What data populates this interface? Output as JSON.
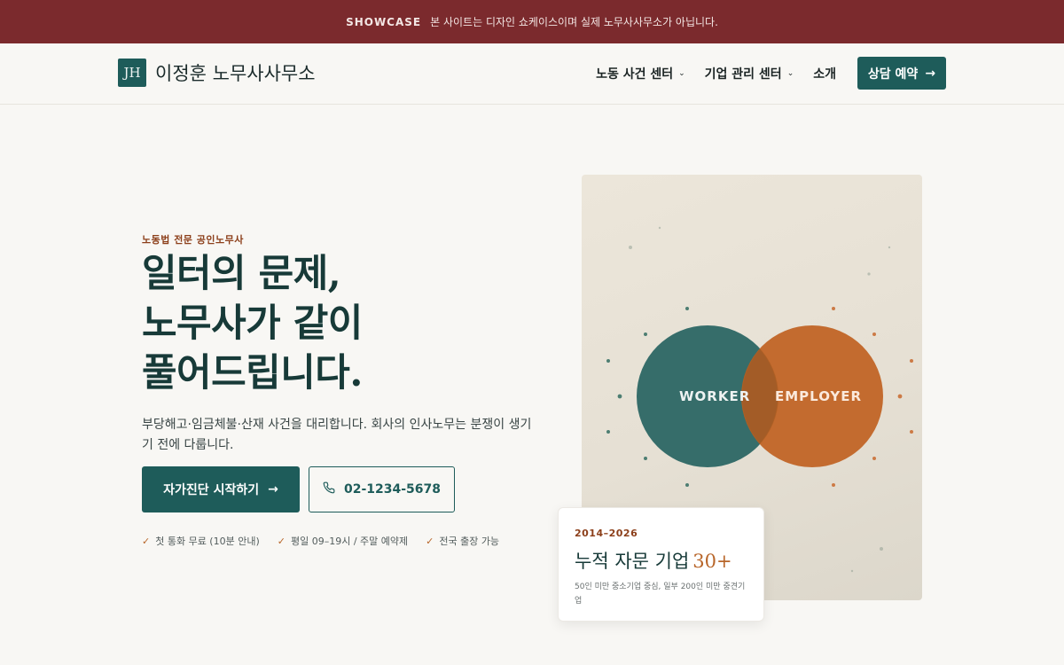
{
  "banner": {
    "tag": "SHOWCASE",
    "text": "본 사이트는 디자인 쇼케이스이며 실제 노무사사무소가 아닙니다."
  },
  "header": {
    "logo_mark": "JH",
    "logo_text": "이정훈 노무사사무소",
    "nav": [
      {
        "label": "노동 사건 센터",
        "dropdown": true
      },
      {
        "label": "기업 관리 센터",
        "dropdown": true
      },
      {
        "label": "소개",
        "dropdown": false
      }
    ],
    "cta_label": "상담 예약",
    "cta_icon": "arrow-right-icon"
  },
  "hero": {
    "eyebrow": "노동법 전문 공인노무사",
    "headline_lines": [
      "일터의 문제,",
      "노무사가 같이",
      "풀어드립니다."
    ],
    "subtext": "부당해고·임금체불·산재 사건을 대리합니다. 회사의 인사노무는 분쟁이 생기기 전에 다룹니다.",
    "primary_button": "자가진단 시작하기",
    "phone_button": "02-1234-5678",
    "checks": [
      "첫 통화 무료 (10분 안내)",
      "평일 09–19시 / 주말 예약제",
      "전국 출장 가능"
    ]
  },
  "illustration": {
    "left_circle": "WORKER",
    "right_circle": "EMPLOYER",
    "colors": {
      "worker": "#2c6664",
      "employer": "#bf5e1d"
    }
  },
  "stat": {
    "years": "2014–2026",
    "title": "누적 자문 기업",
    "number": "30+",
    "note": "50인 미만 중소기업 중심, 일부 200인 미만 중견기업"
  },
  "colors": {
    "brand": "#1e5c5a",
    "banner": "#7b2a2d",
    "accent": "#b8662a",
    "background": "#f8f7f4"
  }
}
